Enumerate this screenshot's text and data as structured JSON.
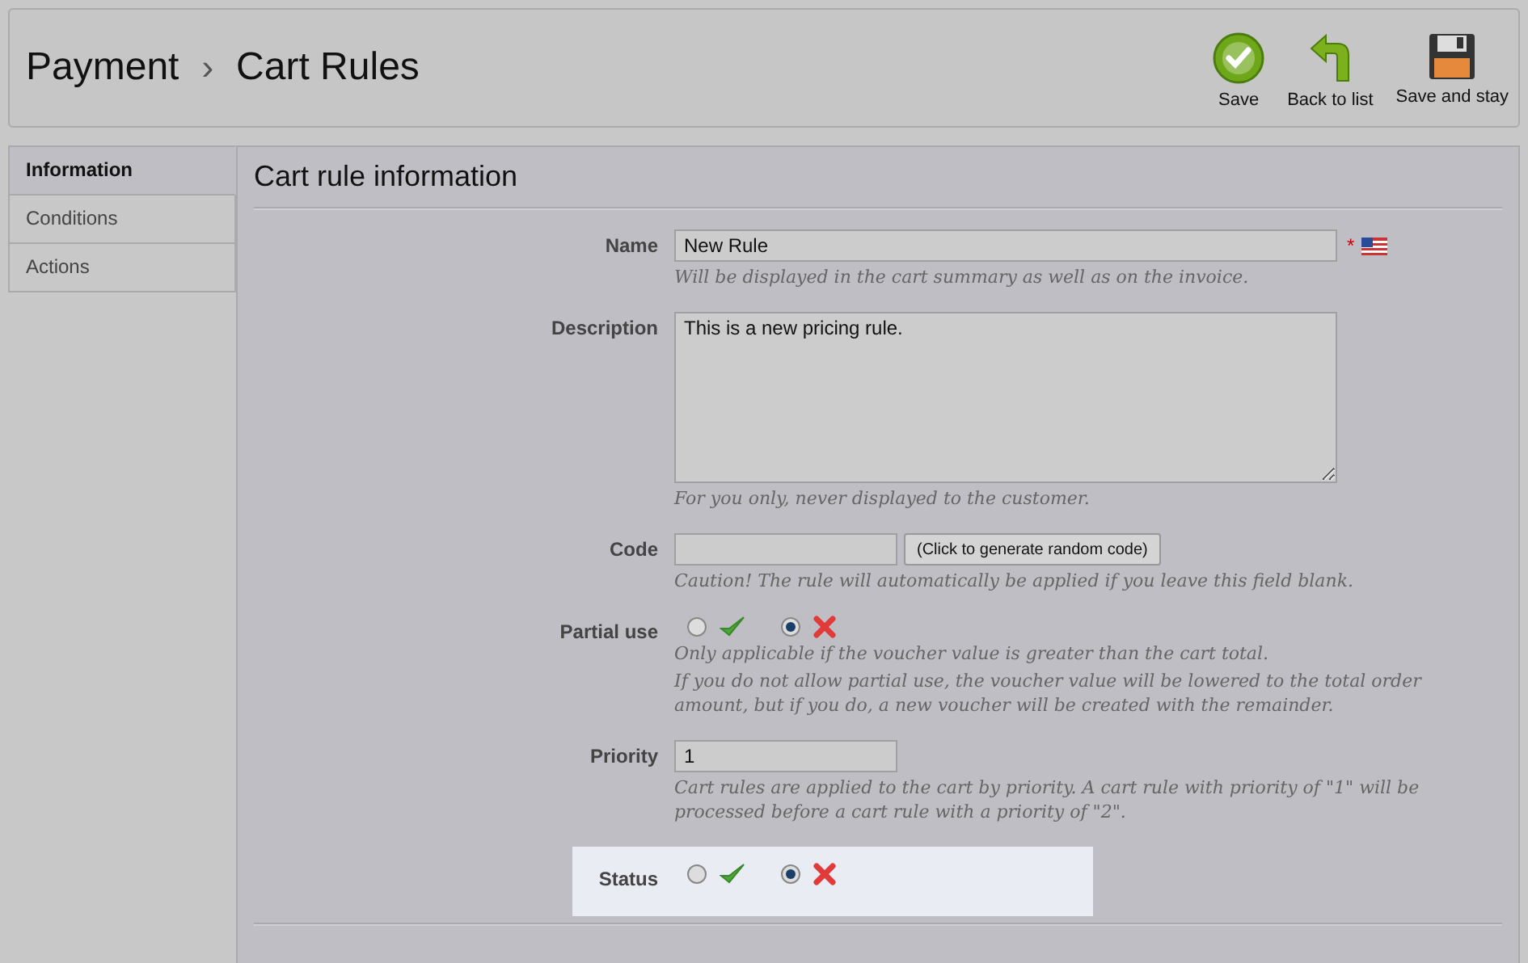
{
  "breadcrumb": {
    "parent": "Payment",
    "separator": "›",
    "current": "Cart Rules"
  },
  "toolbar": [
    {
      "kind": "save",
      "label": "Save"
    },
    {
      "kind": "back",
      "label": "Back to list"
    },
    {
      "kind": "save-stay",
      "label": "Save and stay"
    }
  ],
  "tabs": [
    {
      "label": "Information",
      "selected": true
    },
    {
      "label": "Conditions",
      "selected": false
    },
    {
      "label": "Actions",
      "selected": false
    }
  ],
  "section_title": "Cart rule information",
  "fields": [
    {
      "kind": "text",
      "label": "Name",
      "value": "New Rule",
      "required_mark": "*",
      "hint": [
        "Will be displayed in the cart summary as well as on the invoice."
      ],
      "highlighted": false
    },
    {
      "kind": "textarea",
      "label": "Description",
      "value": "This is a new pricing rule.",
      "hint": [
        "For you only, never displayed to the customer."
      ],
      "highlighted": false
    },
    {
      "kind": "code",
      "label": "Code",
      "button": "(Click to generate random code)",
      "hint": [
        "Caution! The rule will automatically be applied if you leave this field blank."
      ],
      "highlighted": false
    },
    {
      "kind": "radio",
      "label": "Partial use",
      "options": [
        {
          "kind": "yes",
          "selected": false
        },
        {
          "kind": "no",
          "selected": true
        }
      ],
      "hint": [
        "Only applicable if the voucher value is greater than the cart total.",
        "If you do not allow partial use, the voucher value will be lowered to the total order amount, but if you do, a new voucher will be created with the remainder."
      ],
      "highlighted": false
    },
    {
      "kind": "short",
      "label": "Priority",
      "value": "1",
      "hint": [
        "Cart rules are applied to the cart by priority. A cart rule with priority of \"1\" will be processed before a cart rule with a priority of \"2\"."
      ],
      "highlighted": false
    },
    {
      "kind": "radio",
      "label": "Status",
      "options": [
        {
          "kind": "yes",
          "selected": false
        },
        {
          "kind": "no",
          "selected": true
        }
      ],
      "highlighted": true
    }
  ]
}
